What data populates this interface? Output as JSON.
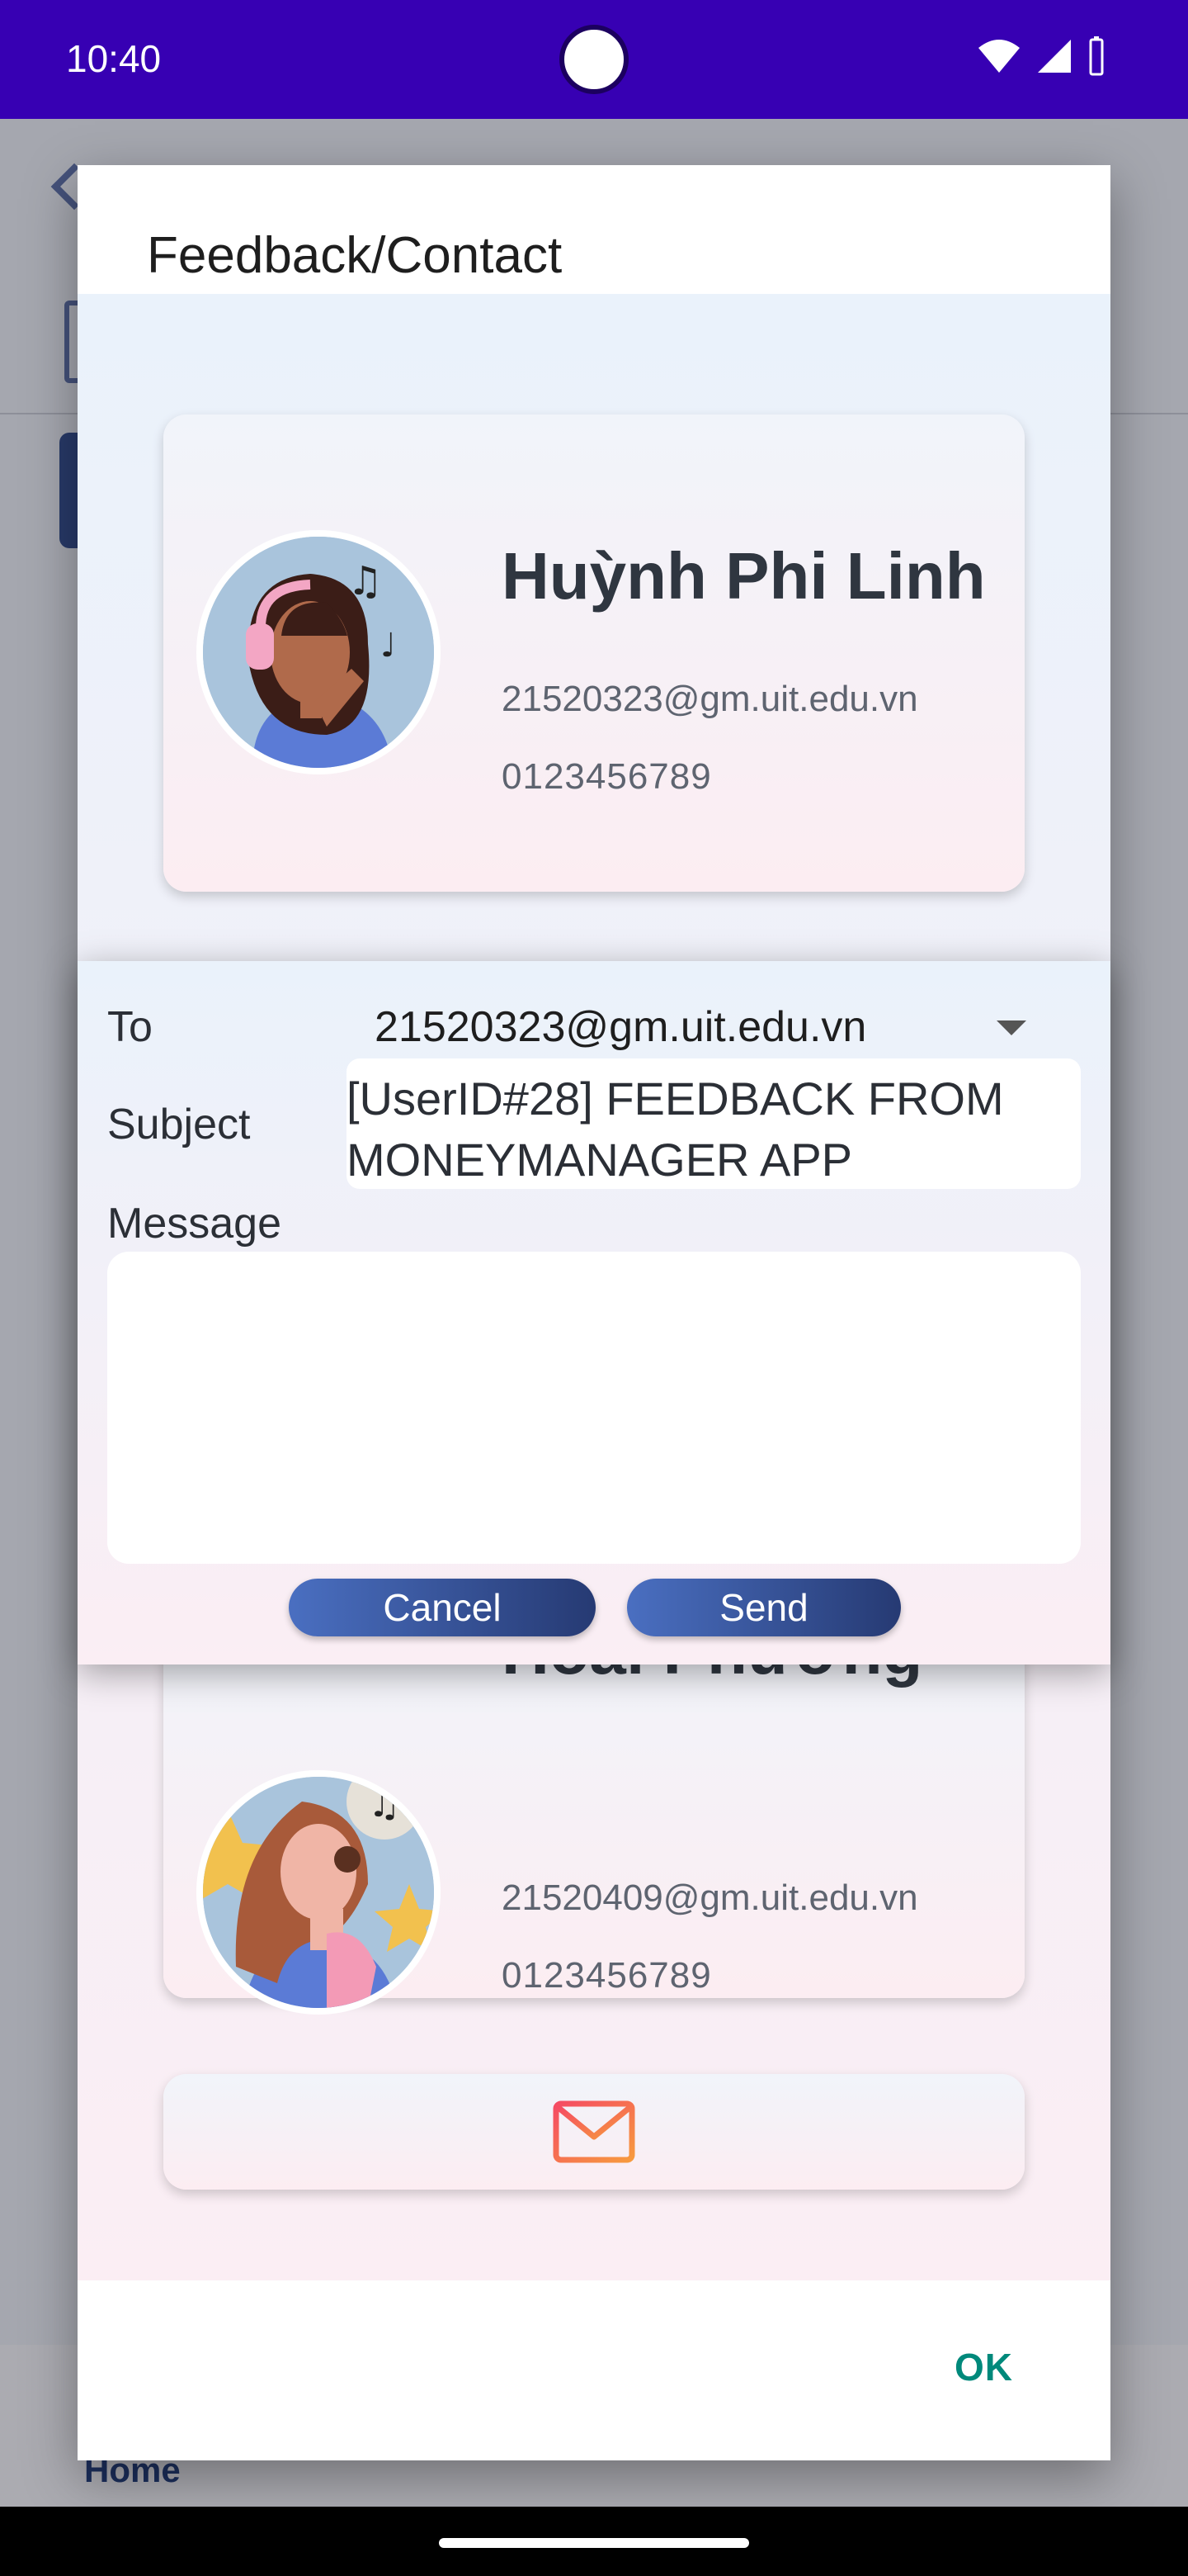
{
  "status_bar": {
    "time": "10:40"
  },
  "background": {
    "nav_home_label": "Home"
  },
  "dialog": {
    "title": "Feedback/Contact",
    "ok_label": "OK",
    "contacts": [
      {
        "name": "Huỳnh Phi Linh",
        "email": "21520323@gm.uit.edu.vn",
        "phone": "0123456789"
      },
      {
        "name": "Hoài Phương",
        "email": "21520409@gm.uit.edu.vn",
        "phone": "0123456789"
      }
    ]
  },
  "compose": {
    "to_label": "To",
    "to_value": "21520323@gm.uit.edu.vn",
    "subject_label": "Subject",
    "subject_line1": "[UserID#28] FEEDBACK FROM",
    "subject_line2": "MONEYMANAGER APP",
    "message_label": "Message",
    "message_value": "",
    "cancel_label": "Cancel",
    "send_label": "Send"
  },
  "colors": {
    "status_bar": "#3700b3",
    "ok_accent": "#00897b",
    "button_gradient_start": "#4a6fc1",
    "button_gradient_end": "#263a73",
    "mail_icon": "#f2604a"
  },
  "icons": [
    "wifi-icon",
    "signal-icon",
    "battery-icon",
    "dropdown-arrow-icon",
    "mail-icon"
  ]
}
